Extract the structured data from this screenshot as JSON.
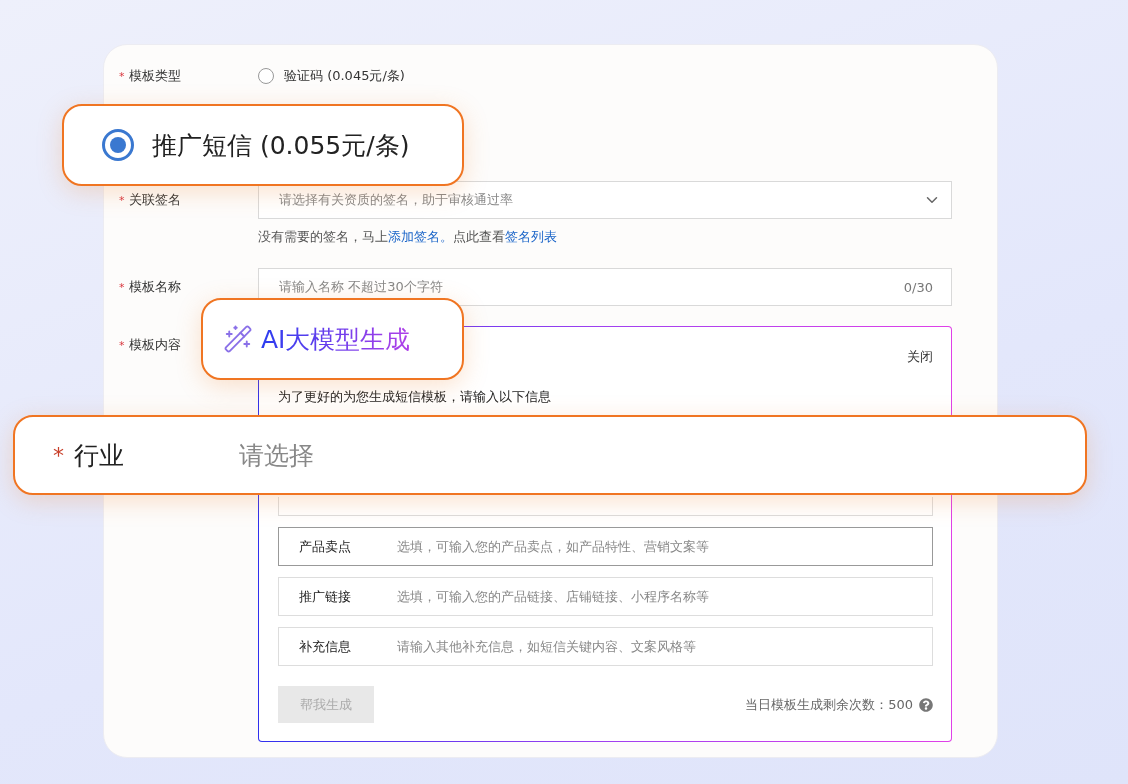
{
  "form": {
    "template_type": {
      "required_mark": "*",
      "label": "模板类型",
      "options": [
        {
          "label": "验证码 (0.045元/条)",
          "selected": false
        }
      ]
    },
    "signature": {
      "required_mark": "*",
      "label": "关联签名",
      "placeholder": "请选择有关资质的签名，助于审核通过率",
      "help": [
        {
          "kind": "text",
          "text": "没有需要的签名，马上"
        },
        {
          "kind": "link",
          "text": "添加签名。"
        },
        {
          "kind": "text",
          "text": "点此查看"
        },
        {
          "kind": "link",
          "text": "签名列表"
        }
      ]
    },
    "template_name": {
      "required_mark": "*",
      "label": "模板名称",
      "placeholder": "请输入名称 不超过30个字符",
      "counter": "0/30"
    },
    "template_content": {
      "required_mark": "*",
      "label": "模板内容",
      "ai_panel": {
        "close": "关闭",
        "intro": "为了更好的为您生成短信模板，请输入以下信息",
        "inputs": [
          {
            "label": "产品卖点",
            "placeholder": "选填，可输入您的产品卖点，如产品特性、营销文案等",
            "focused": true
          },
          {
            "label": "推广链接",
            "placeholder": "选填，可输入您的产品链接、店铺链接、小程序名称等",
            "focused": false
          },
          {
            "label": "补充信息",
            "placeholder": "请输入其他补充信息，如短信关键内容、文案风格等",
            "focused": false
          }
        ],
        "generate_button": {
          "label": "帮我生成",
          "disabled": true
        },
        "quota": "当日模板生成剩余次数：500"
      }
    }
  },
  "callouts": [
    {
      "kind": "radio",
      "label": "推广短信 (0.055元/条)",
      "selected": true
    },
    {
      "kind": "title",
      "text": "AI大模型生成"
    },
    {
      "kind": "field",
      "required_mark": "*",
      "label": "行业",
      "placeholder": "请选择"
    }
  ]
}
